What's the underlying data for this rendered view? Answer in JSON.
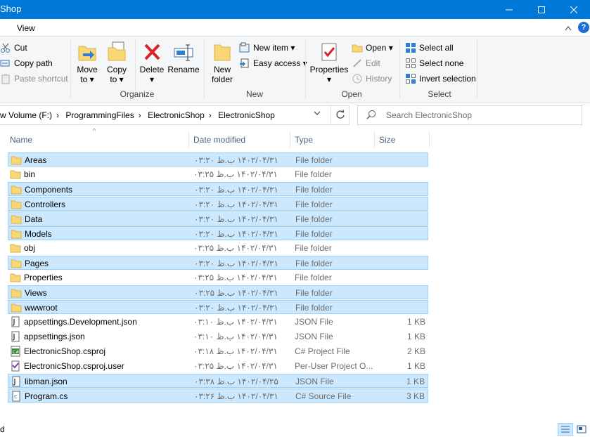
{
  "window": {
    "title": "Shop"
  },
  "menubar": {
    "tab_view": "View"
  },
  "ribbon": {
    "clipboard": {
      "cut": "Cut",
      "copy_path": "Copy path",
      "paste_shortcut": "Paste shortcut"
    },
    "organize": {
      "move_to": "Move",
      "move_to2": "to",
      "copy_to": "Copy",
      "copy_to2": "to",
      "delete": "Delete",
      "rename": "Rename",
      "label": "Organize"
    },
    "new": {
      "new_folder": "New",
      "new_folder2": "folder",
      "new_item": "New item",
      "easy_access": "Easy access",
      "label": "New"
    },
    "open": {
      "properties": "Properties",
      "open": "Open",
      "edit": "Edit",
      "history": "History",
      "label": "Open"
    },
    "select": {
      "select_all": "Select all",
      "select_none": "Select none",
      "invert": "Invert selection",
      "label": "Select"
    }
  },
  "address": {
    "crumbs": [
      "w Volume (F:)",
      "ProgrammingFiles",
      "ElectronicShop",
      "ElectronicShop"
    ],
    "search_placeholder": "Search ElectronicShop"
  },
  "columns": {
    "name": "Name",
    "date": "Date modified",
    "type": "Type",
    "size": "Size"
  },
  "files": [
    {
      "name": "Areas",
      "date": "۱۴۰۲/۰۴/۳۱ ب.ظ ۰۳:۲۰",
      "type": "File folder",
      "size": "",
      "icon": "folder-icon",
      "selected": true
    },
    {
      "name": "bin",
      "date": "۱۴۰۲/۰۴/۳۱ ب.ظ ۰۳:۲۵",
      "type": "File folder",
      "size": "",
      "icon": "folder-icon",
      "selected": false
    },
    {
      "name": "Components",
      "date": "۱۴۰۲/۰۴/۳۱ ب.ظ ۰۳:۲۰",
      "type": "File folder",
      "size": "",
      "icon": "folder-icon",
      "selected": true
    },
    {
      "name": "Controllers",
      "date": "۱۴۰۲/۰۴/۳۱ ب.ظ ۰۳:۲۰",
      "type": "File folder",
      "size": "",
      "icon": "folder-icon",
      "selected": true
    },
    {
      "name": "Data",
      "date": "۱۴۰۲/۰۴/۳۱ ب.ظ ۰۳:۲۰",
      "type": "File folder",
      "size": "",
      "icon": "folder-icon",
      "selected": true
    },
    {
      "name": "Models",
      "date": "۱۴۰۲/۰۴/۳۱ ب.ظ ۰۳:۲۰",
      "type": "File folder",
      "size": "",
      "icon": "folder-icon",
      "selected": true
    },
    {
      "name": "obj",
      "date": "۱۴۰۲/۰۴/۳۱ ب.ظ ۰۳:۲۵",
      "type": "File folder",
      "size": "",
      "icon": "folder-icon",
      "selected": false
    },
    {
      "name": "Pages",
      "date": "۱۴۰۲/۰۴/۳۱ ب.ظ ۰۳:۲۰",
      "type": "File folder",
      "size": "",
      "icon": "folder-icon",
      "selected": true
    },
    {
      "name": "Properties",
      "date": "۱۴۰۲/۰۴/۳۱ ب.ظ ۰۳:۲۵",
      "type": "File folder",
      "size": "",
      "icon": "folder-icon",
      "selected": false
    },
    {
      "name": "Views",
      "date": "۱۴۰۲/۰۴/۳۱ ب.ظ ۰۳:۲۵",
      "type": "File folder",
      "size": "",
      "icon": "folder-icon",
      "selected": true
    },
    {
      "name": "wwwroot",
      "date": "۱۴۰۲/۰۴/۳۱ ب.ظ ۰۳:۲۰",
      "type": "File folder",
      "size": "",
      "icon": "folder-icon",
      "selected": true
    },
    {
      "name": "appsettings.Development.json",
      "date": "۱۴۰۲/۰۴/۳۱ ب.ظ ۰۳:۱۰",
      "type": "JSON File",
      "size": "1 KB",
      "icon": "json-file-icon",
      "selected": false
    },
    {
      "name": "appsettings.json",
      "date": "۱۴۰۲/۰۴/۳۱ ب.ظ ۰۳:۱۰",
      "type": "JSON File",
      "size": "1 KB",
      "icon": "json-file-icon",
      "selected": false
    },
    {
      "name": "ElectronicShop.csproj",
      "date": "۱۴۰۲/۰۴/۳۱ ب.ظ ۰۳:۱۸",
      "type": "C# Project File",
      "size": "2 KB",
      "icon": "csproj-file-icon",
      "selected": false
    },
    {
      "name": "ElectronicShop.csproj.user",
      "date": "۱۴۰۲/۰۴/۳۱ ب.ظ ۰۳:۲۵",
      "type": "Per-User Project O...",
      "size": "1 KB",
      "icon": "user-file-icon",
      "selected": false
    },
    {
      "name": "libman.json",
      "date": "۱۴۰۲/۰۴/۲۵ ب.ظ ۰۳:۳۸",
      "type": "JSON File",
      "size": "1 KB",
      "icon": "json-file-icon",
      "selected": true
    },
    {
      "name": "Program.cs",
      "date": "۱۴۰۲/۰۴/۳۱ ب.ظ ۰۳:۲۶",
      "type": "C# Source File",
      "size": "3 KB",
      "icon": "cs-file-icon",
      "selected": true
    }
  ],
  "status": {
    "text": "d"
  },
  "colors": {
    "titlebar": "#0078d7",
    "selection": "#cce8ff",
    "selection_border": "#99d1ff",
    "folder": "#f8d775"
  }
}
